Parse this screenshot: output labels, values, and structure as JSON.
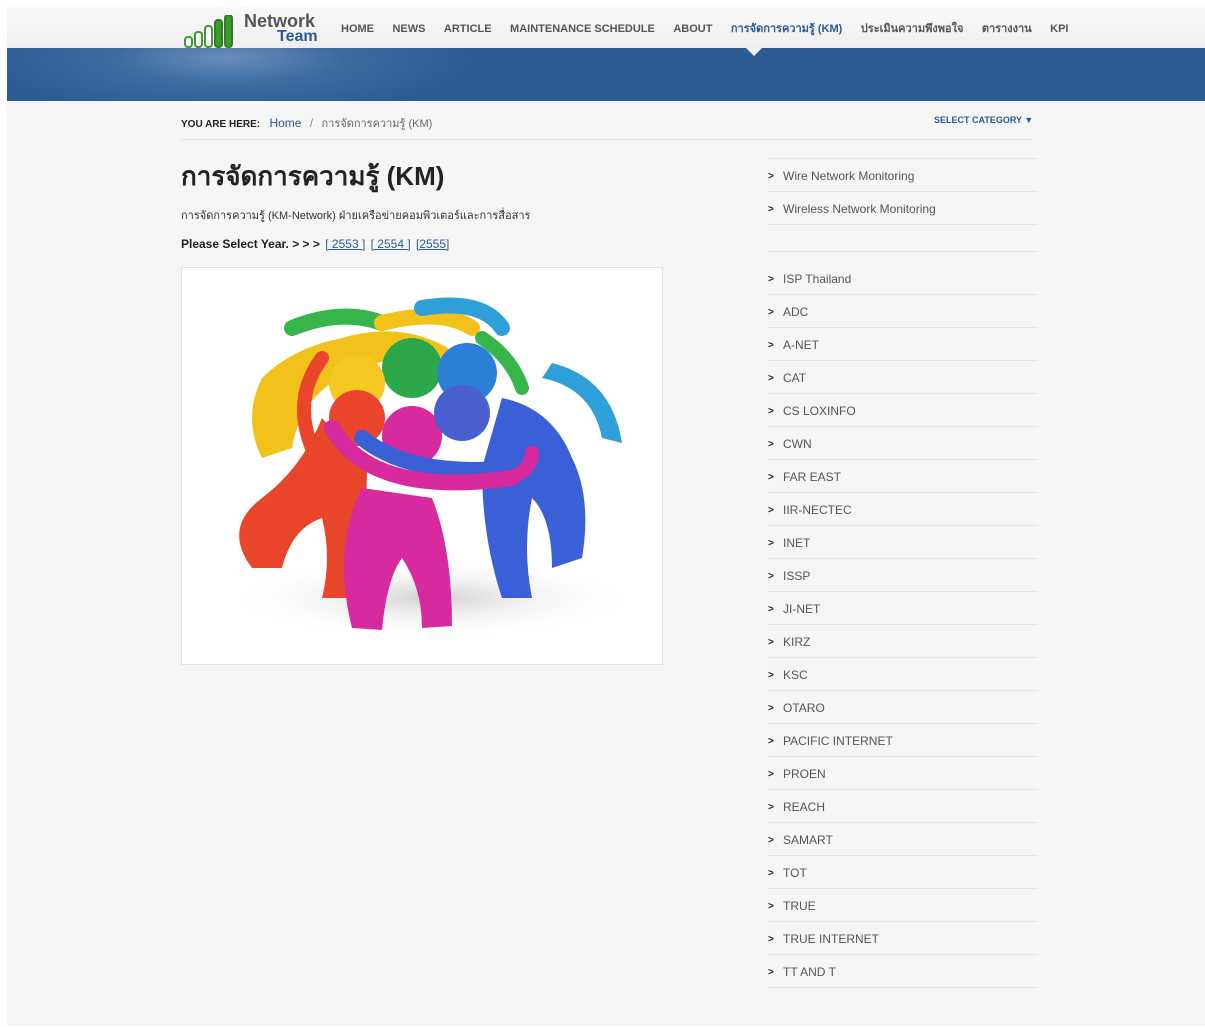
{
  "logo": {
    "line1": "Network",
    "line2": "Team"
  },
  "nav": [
    {
      "label": "HOME",
      "active": false
    },
    {
      "label": "NEWS",
      "active": false
    },
    {
      "label": "ARTICLE",
      "active": false
    },
    {
      "label": "MAINTENANCE SCHEDULE",
      "active": false
    },
    {
      "label": "ABOUT",
      "active": false
    },
    {
      "label": "การจัดการความรู้ (KM)",
      "active": true
    },
    {
      "label": "ประเมินความพึงพอใจ",
      "active": false
    },
    {
      "label": "ตารางงาน",
      "active": false
    },
    {
      "label": "KPI",
      "active": false
    }
  ],
  "breadcrumb": {
    "label": "YOU ARE HERE:",
    "home": "Home",
    "separator": "/",
    "current": "การจัดการความรู้ (KM)"
  },
  "select_category": "SELECT CATEGORY ▼",
  "page": {
    "title": "การจัดการความรู้ (KM)",
    "description": "การจัดการความรู้ (KM-Network) ฝ่ายเครือข่ายคอมพิวเตอร์และการสื่อสาร",
    "year_prompt": "Please Select Year. > > >",
    "years": [
      "[ 2553 ]",
      "[ 2554 ]",
      "[2555]"
    ]
  },
  "sidebar": {
    "group1": [
      "Wire Network Monitoring",
      "Wireless Network Monitoring"
    ],
    "group2": [
      "ISP Thailand",
      "ADC",
      "A-NET",
      "CAT",
      "CS LOXINFO",
      "CWN",
      "FAR EAST",
      "IIR-NECTEC",
      "INET",
      "ISSP",
      "JI-NET",
      "KIRZ",
      "KSC",
      "OTARO",
      "PACIFIC INTERNET",
      "PROEN",
      "REACH",
      "SAMART",
      "TOT",
      "TRUE",
      "TRUE INTERNET",
      "TT AND T"
    ]
  },
  "colors": {
    "accent": "#2a5a95",
    "banner": "#2c5b94"
  }
}
